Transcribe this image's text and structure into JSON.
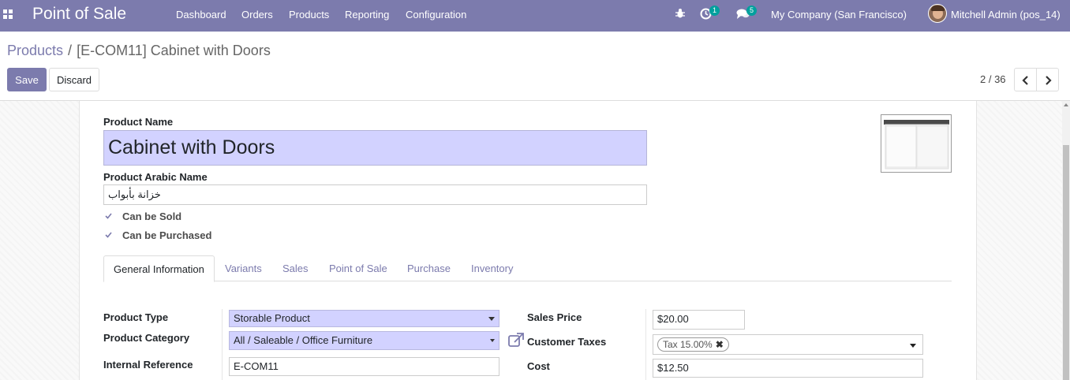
{
  "navbar": {
    "brand": "Point of Sale",
    "menu": [
      "Dashboard",
      "Orders",
      "Products",
      "Reporting",
      "Configuration"
    ],
    "activity_count": "1",
    "message_count": "5",
    "company": "My Company (San Francisco)",
    "user": "Mitchell Admin (pos_14)",
    "accent_color": "#7C7BAD"
  },
  "breadcrumb": {
    "parent": "Products",
    "separator": "/",
    "current": "[E-COM11] Cabinet with Doors"
  },
  "actions": {
    "save": "Save",
    "discard": "Discard"
  },
  "pager": {
    "value": "2 / 36",
    "prev_icon": "chevron-left-icon",
    "next_icon": "chevron-right-icon"
  },
  "form": {
    "product_name_label": "Product Name",
    "product_name": "Cabinet with Doors",
    "arabic_name_label": "Product Arabic Name",
    "arabic_name": "خزانة بأبواب",
    "can_be_sold_label": "Can be Sold",
    "can_be_sold": true,
    "can_be_purchased_label": "Can be Purchased",
    "can_be_purchased": true,
    "tabs": [
      "General Information",
      "Variants",
      "Sales",
      "Point of Sale",
      "Purchase",
      "Inventory"
    ],
    "active_tab": "General Information",
    "general": {
      "product_type_label": "Product Type",
      "product_type": "Storable Product",
      "product_category_label": "Product Category",
      "product_category": "All / Saleable / Office Furniture",
      "internal_reference_label": "Internal Reference",
      "internal_reference": "E-COM11",
      "sales_price_label": "Sales Price",
      "sales_price": "$20.00",
      "customer_taxes_label": "Customer Taxes",
      "customer_tax_tag": "Tax 15.00%",
      "cost_label": "Cost",
      "cost": "$12.50"
    }
  }
}
